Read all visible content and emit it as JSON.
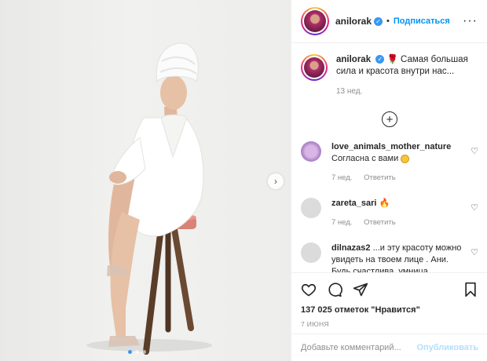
{
  "post": {
    "author": "anilorak",
    "follow_label": "Подписаться",
    "separator": "•",
    "caption_text": "Самая большая сила и красота внутри нас...",
    "caption_rose": "🌹",
    "caption_time": "13 нед.",
    "likes": "137 025 отметок \"Нравится\"",
    "date": "7 ИЮНЯ",
    "photo_index": 1,
    "photo_count": 3
  },
  "comments": [
    {
      "user": "love_animals_mother_nature",
      "text": "Согласна с вами",
      "emoji": "smile",
      "time": "7 нед.",
      "reply": "Ответить"
    },
    {
      "user": "zareta_sari",
      "text": "",
      "emoji": "🔥",
      "time": "7 нед.",
      "reply": "Ответить"
    },
    {
      "user": "dilnazas2",
      "text": "...и эту красоту можно увидеть на твоем лице . Ани. Будь счастлива, умница.",
      "emoji": "",
      "time": "",
      "reply": ""
    }
  ],
  "input": {
    "placeholder": "Добавьте комментарий...",
    "publish": "Опубликовать"
  },
  "colors": {
    "accent": "#0095f6",
    "publish_disabled": "#b2dffc",
    "muted": "#8e8e8e"
  },
  "icons": [
    "verified-icon",
    "more-options-icon",
    "add-circle-icon",
    "heart-icon",
    "comment-icon",
    "share-icon",
    "bookmark-icon",
    "chevron-right-icon"
  ]
}
